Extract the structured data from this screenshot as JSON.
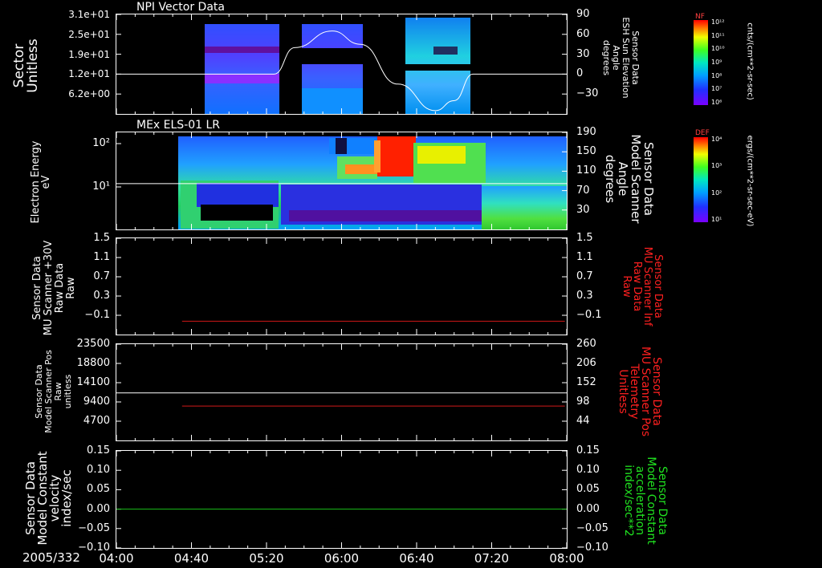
{
  "date_label": "2005/332",
  "colors": {
    "red_line": "#d01818",
    "green_line": "#19c019",
    "white": "#ffffff",
    "red_label": "#ff2020",
    "green_label": "#20e020"
  },
  "time_ticks": [
    "04:00",
    "04:40",
    "05:20",
    "06:00",
    "06:40",
    "07:20",
    "08:00"
  ],
  "panels": {
    "p1": {
      "title": "NPI Vector Data",
      "left_label": [
        "Sector",
        "Unitless"
      ],
      "left_ticks": [
        "3.1e+01",
        "2.5e+01",
        "1.9e+01",
        "1.2e+01",
        "6.2e+00"
      ],
      "right_label": [
        "Sensor Data",
        "ESH Sun Elevation",
        "Angle",
        "degrees"
      ],
      "right_ticks": [
        "90",
        "60",
        "30",
        "0",
        "−30"
      ],
      "cbar_title": "NF",
      "cbar_unit": "cnts/(cm**2-sr-sec)",
      "cbar_ticks": [
        "10¹²",
        "10¹¹",
        "10¹⁰",
        "10⁹",
        "10⁸",
        "10⁷",
        "10⁶"
      ]
    },
    "p2": {
      "title": "MEx ELS-01 LR",
      "left_label": [
        "Electron Energy",
        "eV"
      ],
      "left_ticks": [
        "10²",
        "10¹"
      ],
      "right_label": [
        "Sensor Data",
        "Model Scanner",
        "Angle",
        "degrees"
      ],
      "right_ticks": [
        "190",
        "150",
        "110",
        "70",
        "30"
      ],
      "cbar_title": "DEF",
      "cbar_unit": "ergs/(cm**2-sr-sec-eV)",
      "cbar_ticks": [
        "10⁴",
        "10³",
        "10²",
        "10¹"
      ]
    },
    "p3": {
      "left_label": [
        "Sensor Data",
        "MU Scanner +30V",
        "Raw Data",
        "Raw"
      ],
      "left_ticks": [
        "1.5",
        "1.1",
        "0.7",
        "0.3",
        "−0.1"
      ],
      "right_label": [
        "Sensor Data",
        "MU Scanner Inf",
        "Raw Data",
        "Raw"
      ],
      "right_ticks": [
        "1.5",
        "1.1",
        "0.7",
        "0.3",
        "−0.1"
      ]
    },
    "p4": {
      "left_label": [
        "Sensor Data",
        "Model Scanner Pos",
        "Raw",
        "unitless"
      ],
      "left_ticks": [
        "23500",
        "18800",
        "14100",
        "9400",
        "4700"
      ],
      "right_label": [
        "Sensor Data",
        "MU Scanner Pos",
        "Telemetry",
        "Unitless"
      ],
      "right_ticks": [
        "260",
        "206",
        "152",
        "98",
        "44"
      ]
    },
    "p5": {
      "left_label": [
        "Sensor Data",
        "Model Constant",
        "velocity",
        "index/sec"
      ],
      "left_ticks": [
        "0.15",
        "0.10",
        "0.05",
        "0.00",
        "−0.05",
        "−0.10"
      ],
      "right_label": [
        "Sensor Data",
        "Model Constant",
        "acceleration",
        "index/sec**2"
      ],
      "right_ticks": [
        "0.15",
        "0.10",
        "0.05",
        "0.00",
        "−0.05",
        "−0.10"
      ]
    }
  },
  "chart_data": [
    {
      "type": "heatmap",
      "title": "NPI Vector Data",
      "ylabel": "Sector Unitless",
      "x_range": [
        "04:00",
        "08:00"
      ],
      "y_ticks": [
        31,
        25,
        19,
        12,
        6.2
      ],
      "data_blocks": [
        [
          "04:53",
          "05:24"
        ],
        [
          "05:37",
          "06:08"
        ],
        [
          "06:25",
          "06:58"
        ]
      ],
      "overlay_series": {
        "name": "Sensor Data ESH Sun Elevation Angle",
        "unit": "degrees",
        "ylim": [
          -60,
          90
        ],
        "x": [
          "04:00",
          "05:24",
          "05:35",
          "05:55",
          "06:10",
          "06:30",
          "06:50",
          "07:00",
          "07:10",
          "08:00"
        ],
        "y": [
          0,
          0,
          40,
          65,
          45,
          -15,
          -55,
          -40,
          0,
          0
        ]
      }
    },
    {
      "type": "heatmap",
      "title": "MEx ELS-01 LR",
      "ylabel": "Electron Energy eV",
      "yscale": "log",
      "x_range": [
        "04:00",
        "08:00"
      ],
      "data_range": [
        "04:33",
        "07:59"
      ],
      "overlay_series": {
        "name": "Sensor Data Model Scanner Angle",
        "unit": "degrees",
        "ylim": [
          10,
          190
        ],
        "x": [
          "04:00",
          "08:00"
        ],
        "y": [
          95,
          95
        ]
      }
    },
    {
      "type": "line",
      "ylabel": "Sensor Data MU Scanner +30V Raw Data Raw",
      "ylim": [
        -0.3,
        1.5
      ],
      "series": [
        {
          "name": "Sensor Data MU Scanner Inf Raw Data Raw",
          "color": "red",
          "x": [
            "04:35",
            "07:59"
          ],
          "y": [
            -0.05,
            -0.05
          ]
        }
      ]
    },
    {
      "type": "line",
      "ylabel": "Sensor Data Model Scanner Pos Raw unitless",
      "ylim": [
        0,
        23500
      ],
      "series": [
        {
          "name": "Sensor Data Model Scanner Pos Raw unitless",
          "color": "white",
          "x": [
            "04:00",
            "08:00"
          ],
          "y": [
            11600,
            11600
          ]
        },
        {
          "name": "Sensor Data MU Scanner Pos Telemetry Unitless",
          "color": "red",
          "x": [
            "04:35",
            "07:59"
          ],
          "y": [
            8400,
            8400
          ]
        }
      ]
    },
    {
      "type": "line",
      "ylabel": "Sensor Data Model Constant velocity index/sec",
      "ylim": [
        -0.1,
        0.15
      ],
      "series": [
        {
          "name": "Sensor Data Model Constant acceleration index/sec**2",
          "color": "green",
          "x": [
            "04:00",
            "08:00"
          ],
          "y": [
            0.0,
            0.0
          ]
        }
      ]
    }
  ]
}
